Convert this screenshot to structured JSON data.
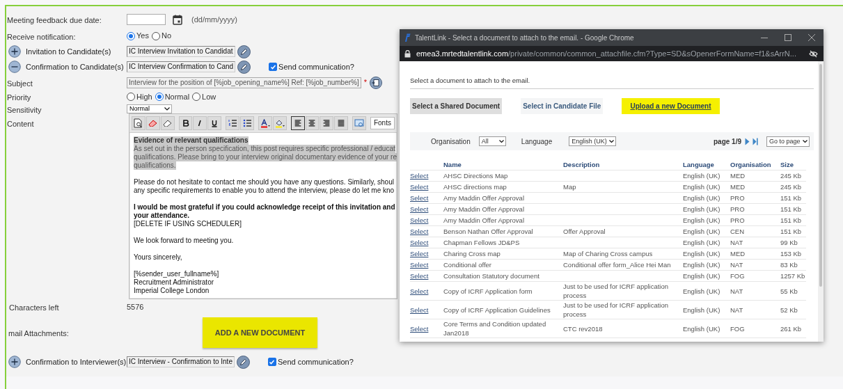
{
  "form": {
    "due_date": {
      "label": "Meeting feedback due date:",
      "hint": "(dd/mm/yyyy)"
    },
    "notification": {
      "label": "Receive notification:",
      "options": [
        {
          "label": "Yes",
          "selected": true
        },
        {
          "label": "No",
          "selected": false
        }
      ]
    },
    "templates": [
      {
        "kind": "expand",
        "label": "Invitation to Candidate(s)",
        "value": "IC Interview Invitation to Candidat"
      },
      {
        "kind": "collapse",
        "label": "Confirmation to Candidate(s)",
        "value": "IC Interview Confirmation to Cand",
        "send": {
          "label": "Send communication?",
          "checked": true
        }
      }
    ],
    "subject": {
      "label": "Subject",
      "value": "Interview for the position of [%job_opening_name%] Ref: [%job_number%]",
      "required_mark": "*"
    },
    "priority": {
      "label": "Priority",
      "options": [
        {
          "label": "High",
          "selected": false
        },
        {
          "label": "Normal",
          "selected": true
        },
        {
          "label": "Low",
          "selected": false
        }
      ]
    },
    "sensitivity": {
      "label": "Sensitivity",
      "value": "Normal"
    },
    "content": {
      "label": "Content",
      "fonts": "Fonts",
      "alignment": [
        {
          "kind": "left",
          "selected": true
        },
        {
          "kind": "center",
          "selected": false
        },
        {
          "kind": "right",
          "selected": false
        },
        {
          "kind": "justify",
          "selected": false
        }
      ],
      "lines": [
        {
          "kind": "highlight-bold",
          "text": "Evidence of relevant qualifications"
        },
        {
          "kind": "highlight",
          "text": "As set out in the person specification, this post requires specific professional / educat"
        },
        {
          "kind": "highlight",
          "text": "qualifications. Please bring to your interview original documentary evidence of your re"
        },
        {
          "kind": "highlight",
          "text": "qualifications."
        },
        {
          "kind": "blank"
        },
        {
          "kind": "normal",
          "text": "Please do not hesitate to contact me should you have any questions. Similarly, shoul"
        },
        {
          "kind": "normal",
          "text": "any specific requirements to enable you to attend the interview, please do let me kno"
        },
        {
          "kind": "blank"
        },
        {
          "kind": "bold",
          "text": "I would be most grateful if you could acknowledge receipt of this invitation and"
        },
        {
          "kind": "bold",
          "text": "your attendance."
        },
        {
          "kind": "normal",
          "text": "[DELETE IF USING SCHEDULER]"
        },
        {
          "kind": "blank"
        },
        {
          "kind": "normal",
          "text": "We look forward to meeting you."
        },
        {
          "kind": "blank"
        },
        {
          "kind": "normal",
          "text": "Yours sincerely,"
        },
        {
          "kind": "blank"
        },
        {
          "kind": "normal",
          "text": "[%sender_user_fullname%]"
        },
        {
          "kind": "normal",
          "text": "Recruitment Administrator"
        },
        {
          "kind": "normal",
          "text": "Imperial College London"
        }
      ]
    },
    "chars_left": {
      "label": "Characters left",
      "value": "5576"
    },
    "attachments": {
      "label": "mail Attachments:",
      "button": "ADD A NEW DOCUMENT"
    },
    "interviewer_template": {
      "kind": "expand",
      "label": "Confirmation to Interviewer(s)",
      "value": "IC Interview - Confirmation to Inte",
      "send": {
        "label": "Send communication?",
        "checked": true
      }
    }
  },
  "popup": {
    "title": "TalentLink - Select a document to attach to the email. - Google Chrome",
    "url_host": "emea3.mrtedtalentlink.com",
    "url_path": "/private/common/common_attachfile.cfm?Type=SD&sOpenerFormName=f1&sArrN...",
    "intro": "Select a document to attach to the email.",
    "tabs": [
      {
        "label": "Select a Shared Document",
        "selected": true
      },
      {
        "label": "Select in Candidate File",
        "selected": false
      },
      {
        "label": "Upload a new Document",
        "selected": false
      }
    ],
    "filters": {
      "organisation_label": "Organisation",
      "organisation_value": "All",
      "language_label": "Language",
      "language_value": "English (UK)",
      "page": "page 1/9",
      "go_to": "Go to page"
    },
    "table": {
      "columns": [
        "Name",
        "Description",
        "Language",
        "Organisation",
        "Size"
      ],
      "rows": [
        {
          "action": "Select",
          "name": "AHSC Directions Map",
          "description": "",
          "language": "English (UK)",
          "organisation": "MED",
          "size": "245 Kb"
        },
        {
          "action": "Select",
          "name": "AHSC directions map",
          "description": "Map",
          "language": "English (UK)",
          "organisation": "MED",
          "size": "245 Kb"
        },
        {
          "action": "Select",
          "name": "Amy Maddin Offer Approval",
          "description": "",
          "language": "English (UK)",
          "organisation": "PRO",
          "size": "151 Kb"
        },
        {
          "action": "Select",
          "name": "Amy Maddin Offer Approval",
          "description": "",
          "language": "English (UK)",
          "organisation": "PRO",
          "size": "151 Kb"
        },
        {
          "action": "Select",
          "name": "Amy Maddin Offer Approval",
          "description": "",
          "language": "English (UK)",
          "organisation": "PRO",
          "size": "151 Kb"
        },
        {
          "action": "Select",
          "name": "Benson Nathan Offer Approval",
          "description": "Offer Approval",
          "language": "English (UK)",
          "organisation": "CEN",
          "size": "151 Kb"
        },
        {
          "action": "Select",
          "name": "Chapman Fellows JD&PS",
          "description": "",
          "language": "English (UK)",
          "organisation": "NAT",
          "size": "99 Kb"
        },
        {
          "action": "Select",
          "name": "Charing Cross map",
          "description": "Map of Charing Cross campus",
          "language": "English (UK)",
          "organisation": "MED",
          "size": "153 Kb"
        },
        {
          "action": "Select",
          "name": "Conditional offer",
          "description": "Conditional offer form_Alice Hei Man",
          "language": "English (UK)",
          "organisation": "NAT",
          "size": "83 Kb"
        },
        {
          "action": "Select",
          "name": "Consultation Statutory document",
          "description": "",
          "language": "English (UK)",
          "organisation": "FOG",
          "size": "1257 Kb"
        },
        {
          "action": "Select",
          "name": "Copy of ICRF Application form",
          "description": "Just to be used for ICRF application process",
          "language": "English (UK)",
          "organisation": "NAT",
          "size": "55 Kb"
        },
        {
          "action": "Select",
          "name": "Copy of ICRF Application Guidelines",
          "description": "Just to be used for ICRF application process",
          "language": "English (UK)",
          "organisation": "NAT",
          "size": "52 Kb"
        },
        {
          "action": "Select",
          "name": "Core Terms and Condition updated Jan2018",
          "description": "CTC rev2018",
          "language": "English (UK)",
          "organisation": "FOG",
          "size": "261 Kb"
        }
      ]
    }
  }
}
